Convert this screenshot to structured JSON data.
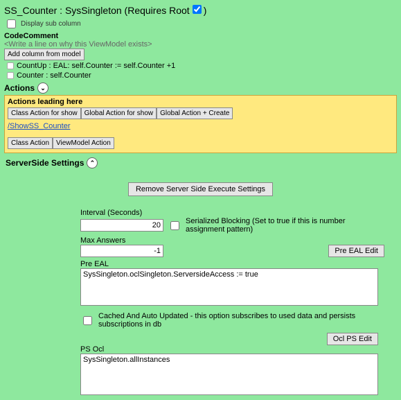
{
  "header": {
    "title": "SS_Counter : SysSingleton  (Requires Root",
    "title_suffix": ")",
    "requires_root_checked": true,
    "display_sub_column_label": "Display sub column",
    "display_sub_column_checked": false
  },
  "code_comment": {
    "label": "CodeComment",
    "placeholder": "<Write a line on why this ViewModel exists>",
    "add_column_btn": "Add column from model"
  },
  "members": {
    "count_up": "CountUp : EAL: self.Counter := self.Counter +1",
    "counter": "Counter : self.Counter"
  },
  "actions": {
    "header": "Actions",
    "leading_label": "Actions leading here",
    "btn_class_show": "Class Action for show",
    "btn_global_show": "Global Action for show",
    "btn_global_create": "Global Action + Create",
    "link_show": "/ShowSS_Counter",
    "btn_class_action": "Class Action",
    "btn_vm_action": "ViewModel Action"
  },
  "serverside": {
    "header": "ServerSide Settings",
    "remove_btn": "Remove Server Side Execute Settings",
    "interval_label": "Interval (Seconds)",
    "interval_value": "20",
    "serialized_checked": false,
    "serialized_label": "Serialized Blocking (Set to true if this is number assignment pattern)",
    "max_answers_label": "Max Answers",
    "max_answers_value": "-1",
    "pre_eal_btn": "Pre EAL Edit",
    "pre_eal_label": "Pre EAL",
    "pre_eal_value": "SysSingleton.oclSingleton.ServersideAccess := true",
    "cached_checked": false,
    "cached_label": "Cached And Auto Updated - this option subscribes to used data and persists subscriptions in db",
    "ocl_ps_btn": "Ocl PS Edit",
    "ps_ocl_label": "PS Ocl",
    "ps_ocl_value": "SysSingleton.allInstances"
  }
}
